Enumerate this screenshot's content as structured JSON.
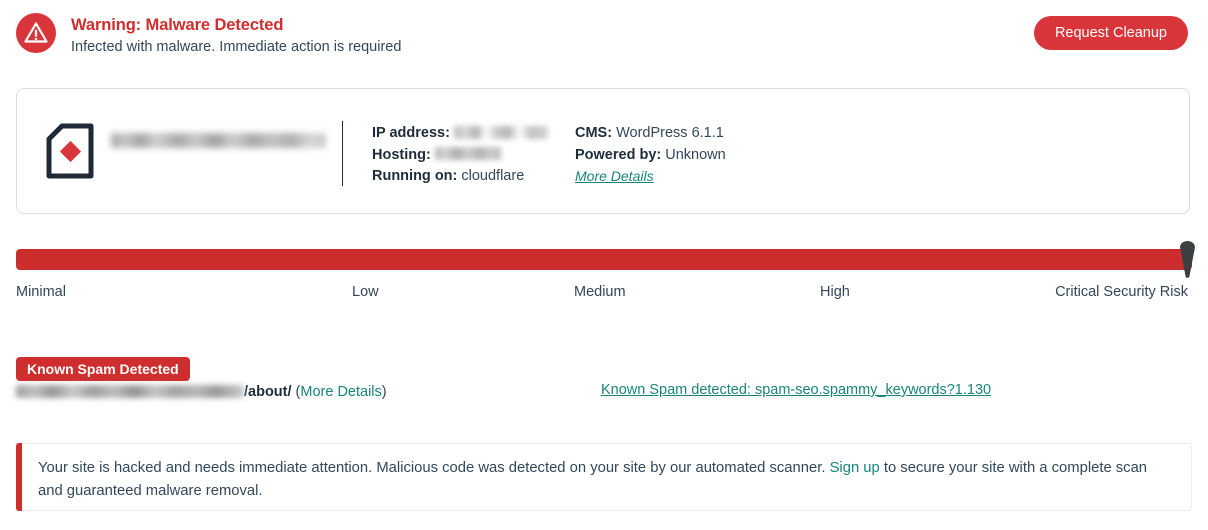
{
  "header": {
    "icon": "warning-triangle-icon",
    "title": "Warning: Malware Detected",
    "subtitle": "Infected with malware. Immediate action is required",
    "cleanup_button": "Request Cleanup",
    "title_color": "#cf2e2e",
    "button_color": "#d8363a"
  },
  "site_card": {
    "logo_icon": "site-logo-icon",
    "url_redacted": true,
    "details_left": [
      {
        "label": "IP address:",
        "value": "",
        "redacted": true
      },
      {
        "label": "Hosting:",
        "value": "",
        "redacted": true
      },
      {
        "label": "Running on:",
        "value": "cloudflare",
        "redacted": false
      }
    ],
    "details_right": [
      {
        "label": "CMS:",
        "value": "WordPress 6.1.1"
      },
      {
        "label": "Powered by:",
        "value": "Unknown"
      }
    ],
    "more_details_link": "More Details"
  },
  "risk_meter": {
    "level_labels": [
      "Minimal",
      "Low",
      "Medium",
      "High",
      "Critical Security Risk"
    ],
    "current_level": "Critical Security Risk",
    "fill_percent": 100,
    "bar_color": "#cc2d2d",
    "marker_color": "#3c4043"
  },
  "findings": [
    {
      "badge": "Known Spam Detected",
      "badge_color": "#cf2e2e",
      "url_redacted": true,
      "url_path": "/about/",
      "more_details_label": "More Details",
      "detection_link": "Known Spam detected: spam-seo.spammy_keywords?1.130"
    }
  ],
  "alert": {
    "text_before_link": "Your site is hacked and needs immediate attention. Malicious code was detected on your site by our automated scanner. ",
    "link_label": "Sign up",
    "text_after_link": " to secure your site with a complete scan and guaranteed malware removal.",
    "accent_color": "#cf2e2e",
    "link_color": "#19847b"
  }
}
